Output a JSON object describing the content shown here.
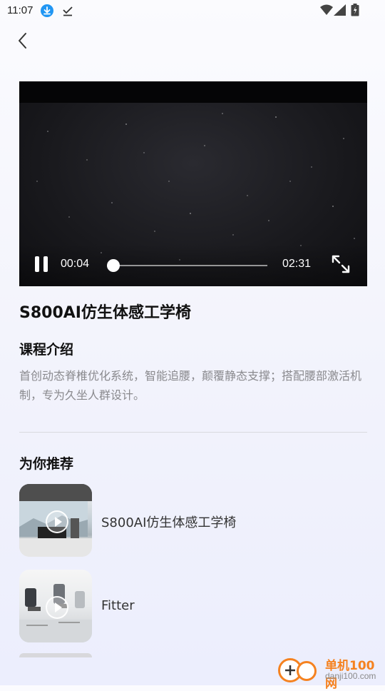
{
  "status_bar": {
    "time": "11:07"
  },
  "video": {
    "current_time": "00:04",
    "total_time": "02:31",
    "progress": 0.026
  },
  "product": {
    "title": "S800AI仿生体感工学椅"
  },
  "intro": {
    "heading": "课程介绍",
    "text": "首创动态脊椎优化系统，智能追腰，颠覆静态支撑；搭配腰部激活机制，专为久坐人群设计。"
  },
  "recommend": {
    "heading": "为你推荐",
    "items": [
      {
        "label": "S800AI仿生体感工学椅"
      },
      {
        "label": "Fitter"
      }
    ]
  },
  "watermark": {
    "brand": "单机100网",
    "domain": "danji100.com"
  },
  "colors": {
    "accent_watermark": "#f58220",
    "download_badge": "#2196f3"
  }
}
